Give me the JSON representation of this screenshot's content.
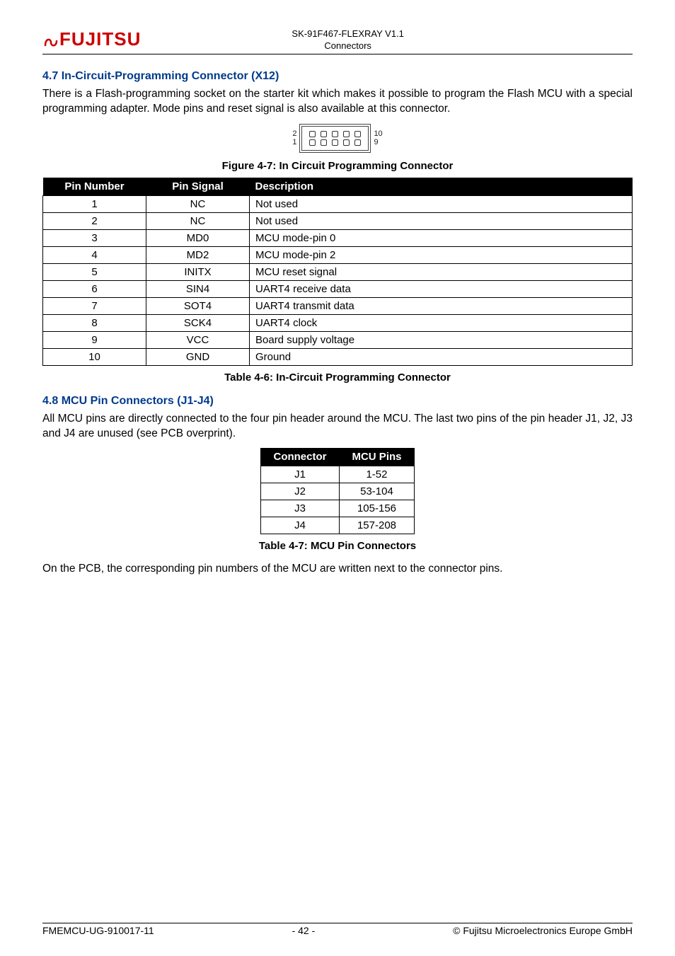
{
  "header": {
    "doc_title": "SK-91F467-FLEXRAY V1.1",
    "section_label": "Connectors",
    "logo_text": "FUJITSU"
  },
  "sec47": {
    "heading": "4.7   In-Circuit-Programming Connector (X12)",
    "para": "There is a Flash-programming socket on the starter kit which makes it possible to program the Flash MCU with a special programming adapter. Mode pins and reset signal is also available at this connector.",
    "pin_left_top": "2",
    "pin_left_bot": "1",
    "pin_right_top": "10",
    "pin_right_bot": "9",
    "fig_caption": "Figure 4-7: In Circuit Programming Connector",
    "table_caption": "Table 4-6: In-Circuit Programming Connector",
    "cols": {
      "c0": "Pin Number",
      "c1": "Pin Signal",
      "c2": "Description"
    },
    "rows": [
      {
        "num": "1",
        "sig": "NC",
        "desc": "Not used"
      },
      {
        "num": "2",
        "sig": "NC",
        "desc": "Not used"
      },
      {
        "num": "3",
        "sig": "MD0",
        "desc": "MCU mode-pin 0"
      },
      {
        "num": "4",
        "sig": "MD2",
        "desc": "MCU mode-pin 2"
      },
      {
        "num": "5",
        "sig": "INITX",
        "desc": "MCU reset signal"
      },
      {
        "num": "6",
        "sig": "SIN4",
        "desc": "UART4 receive data"
      },
      {
        "num": "7",
        "sig": "SOT4",
        "desc": "UART4 transmit data"
      },
      {
        "num": "8",
        "sig": "SCK4",
        "desc": "UART4 clock"
      },
      {
        "num": "9",
        "sig": "VCC",
        "desc": "Board supply voltage"
      },
      {
        "num": "10",
        "sig": "GND",
        "desc": "Ground"
      }
    ]
  },
  "sec48": {
    "heading": "4.8   MCU Pin Connectors (J1-J4)",
    "para": "All MCU pins are directly connected to the four pin header around the MCU. The last two pins of the pin header J1, J2, J3 and J4 are unused (see PCB overprint).",
    "cols": {
      "c0": "Connector",
      "c1": "MCU Pins"
    },
    "rows": [
      {
        "conn": "J1",
        "pins": "1-52"
      },
      {
        "conn": "J2",
        "pins": "53-104"
      },
      {
        "conn": "J3",
        "pins": "105-156"
      },
      {
        "conn": "J4",
        "pins": "157-208"
      }
    ],
    "table_caption": "Table 4-7: MCU Pin Connectors",
    "para2": "On the PCB, the corresponding pin numbers of the MCU are written next to the connector pins."
  },
  "footer": {
    "left": "FMEMCU-UG-910017-11",
    "center": "- 42 -",
    "right": "© Fujitsu Microelectronics Europe GmbH"
  },
  "chart_data": [
    {
      "type": "table",
      "title": "In-Circuit Programming Connector (X12)",
      "columns": [
        "Pin Number",
        "Pin Signal",
        "Description"
      ],
      "rows": [
        [
          1,
          "NC",
          "Not used"
        ],
        [
          2,
          "NC",
          "Not used"
        ],
        [
          3,
          "MD0",
          "MCU mode-pin 0"
        ],
        [
          4,
          "MD2",
          "MCU mode-pin 2"
        ],
        [
          5,
          "INITX",
          "MCU reset signal"
        ],
        [
          6,
          "SIN4",
          "UART4 receive data"
        ],
        [
          7,
          "SOT4",
          "UART4 transmit data"
        ],
        [
          8,
          "SCK4",
          "UART4 clock"
        ],
        [
          9,
          "VCC",
          "Board supply voltage"
        ],
        [
          10,
          "GND",
          "Ground"
        ]
      ]
    },
    {
      "type": "table",
      "title": "MCU Pin Connectors (J1-J4)",
      "columns": [
        "Connector",
        "MCU Pins"
      ],
      "rows": [
        [
          "J1",
          "1-52"
        ],
        [
          "J2",
          "53-104"
        ],
        [
          "J3",
          "105-156"
        ],
        [
          "J4",
          "157-208"
        ]
      ]
    }
  ]
}
